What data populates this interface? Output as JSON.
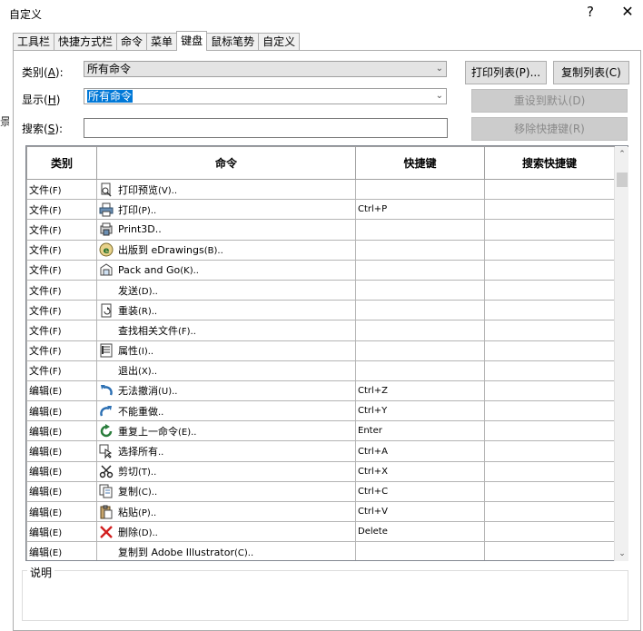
{
  "window": {
    "title": "自定义",
    "help": "?",
    "close": "✕"
  },
  "left_clip": "景",
  "tabs": [
    "工具栏",
    "快捷方式栏",
    "命令",
    "菜单",
    "键盘",
    "鼠标笔势",
    "自定义"
  ],
  "active_tab": 4,
  "filters": {
    "category": {
      "label": "类别",
      "hotkey": "A",
      "value": "所有命令"
    },
    "show": {
      "label": "显示",
      "hotkey": "H",
      "value": "所有命令"
    },
    "search": {
      "label": "搜索",
      "hotkey": "S",
      "value": ""
    }
  },
  "buttons": {
    "print_list": "打印列表(P)...",
    "copy_list": "复制列表(C)",
    "reset_defaults": "重设到默认(D)",
    "remove_shortcut": "移除快捷键(R)"
  },
  "table": {
    "headers": [
      "类别",
      "命令",
      "快捷键",
      "搜索快捷键"
    ],
    "rows": [
      {
        "category": "文件",
        "cat_key": "(F)",
        "icon": "print-preview-icon",
        "command": "打印预览",
        "cmd_key": "(V)..",
        "shortcut": ""
      },
      {
        "category": "文件",
        "cat_key": "(F)",
        "icon": "printer-icon",
        "command": "打印",
        "cmd_key": "(P)..",
        "shortcut": "Ctrl+P"
      },
      {
        "category": "文件",
        "cat_key": "(F)",
        "icon": "print3d-icon",
        "command": "Print3D..",
        "cmd_key": "",
        "shortcut": ""
      },
      {
        "category": "文件",
        "cat_key": "(F)",
        "icon": "edrawings-icon",
        "command": "出版到 eDrawings",
        "cmd_key": "(B)..",
        "shortcut": ""
      },
      {
        "category": "文件",
        "cat_key": "(F)",
        "icon": "pack-and-go-icon",
        "command": "Pack and Go",
        "cmd_key": "(K)..",
        "shortcut": ""
      },
      {
        "category": "文件",
        "cat_key": "(F)",
        "icon": "",
        "command": "发送",
        "cmd_key": "(D)..",
        "shortcut": ""
      },
      {
        "category": "文件",
        "cat_key": "(F)",
        "icon": "reload-icon",
        "command": "重装",
        "cmd_key": "(R)..",
        "shortcut": ""
      },
      {
        "category": "文件",
        "cat_key": "(F)",
        "icon": "",
        "command": "查找相关文件",
        "cmd_key": "(F)..",
        "shortcut": ""
      },
      {
        "category": "文件",
        "cat_key": "(F)",
        "icon": "properties-icon",
        "command": "属性",
        "cmd_key": "(I)..",
        "shortcut": ""
      },
      {
        "category": "文件",
        "cat_key": "(F)",
        "icon": "",
        "command": "退出",
        "cmd_key": "(X)..",
        "shortcut": ""
      },
      {
        "category": "编辑",
        "cat_key": "(E)",
        "icon": "undo-icon",
        "command": "无法撤消",
        "cmd_key": "(U)..",
        "shortcut": "Ctrl+Z"
      },
      {
        "category": "编辑",
        "cat_key": "(E)",
        "icon": "redo-icon",
        "command": "不能重做",
        "cmd_key": "..",
        "shortcut": "Ctrl+Y"
      },
      {
        "category": "编辑",
        "cat_key": "(E)",
        "icon": "repeat-icon",
        "command": "重复上一命令",
        "cmd_key": "(E)..",
        "shortcut": "Enter"
      },
      {
        "category": "编辑",
        "cat_key": "(E)",
        "icon": "select-all-icon",
        "command": "选择所有",
        "cmd_key": "..",
        "shortcut": "Ctrl+A"
      },
      {
        "category": "编辑",
        "cat_key": "(E)",
        "icon": "scissors-icon",
        "command": "剪切",
        "cmd_key": "(T)..",
        "shortcut": "Ctrl+X"
      },
      {
        "category": "编辑",
        "cat_key": "(E)",
        "icon": "copy-icon",
        "command": "复制",
        "cmd_key": "(C)..",
        "shortcut": "Ctrl+C"
      },
      {
        "category": "编辑",
        "cat_key": "(E)",
        "icon": "paste-icon",
        "command": "粘贴",
        "cmd_key": "(P)..",
        "shortcut": "Ctrl+V"
      },
      {
        "category": "编辑",
        "cat_key": "(E)",
        "icon": "delete-icon",
        "command": "删除",
        "cmd_key": "(D)..",
        "shortcut": "Delete"
      },
      {
        "category": "编辑",
        "cat_key": "(E)",
        "icon": "",
        "command": "复制到 Adobe Illustrator",
        "cmd_key": "(C)..",
        "shortcut": ""
      }
    ]
  },
  "description": {
    "label": "说明",
    "text": ""
  }
}
